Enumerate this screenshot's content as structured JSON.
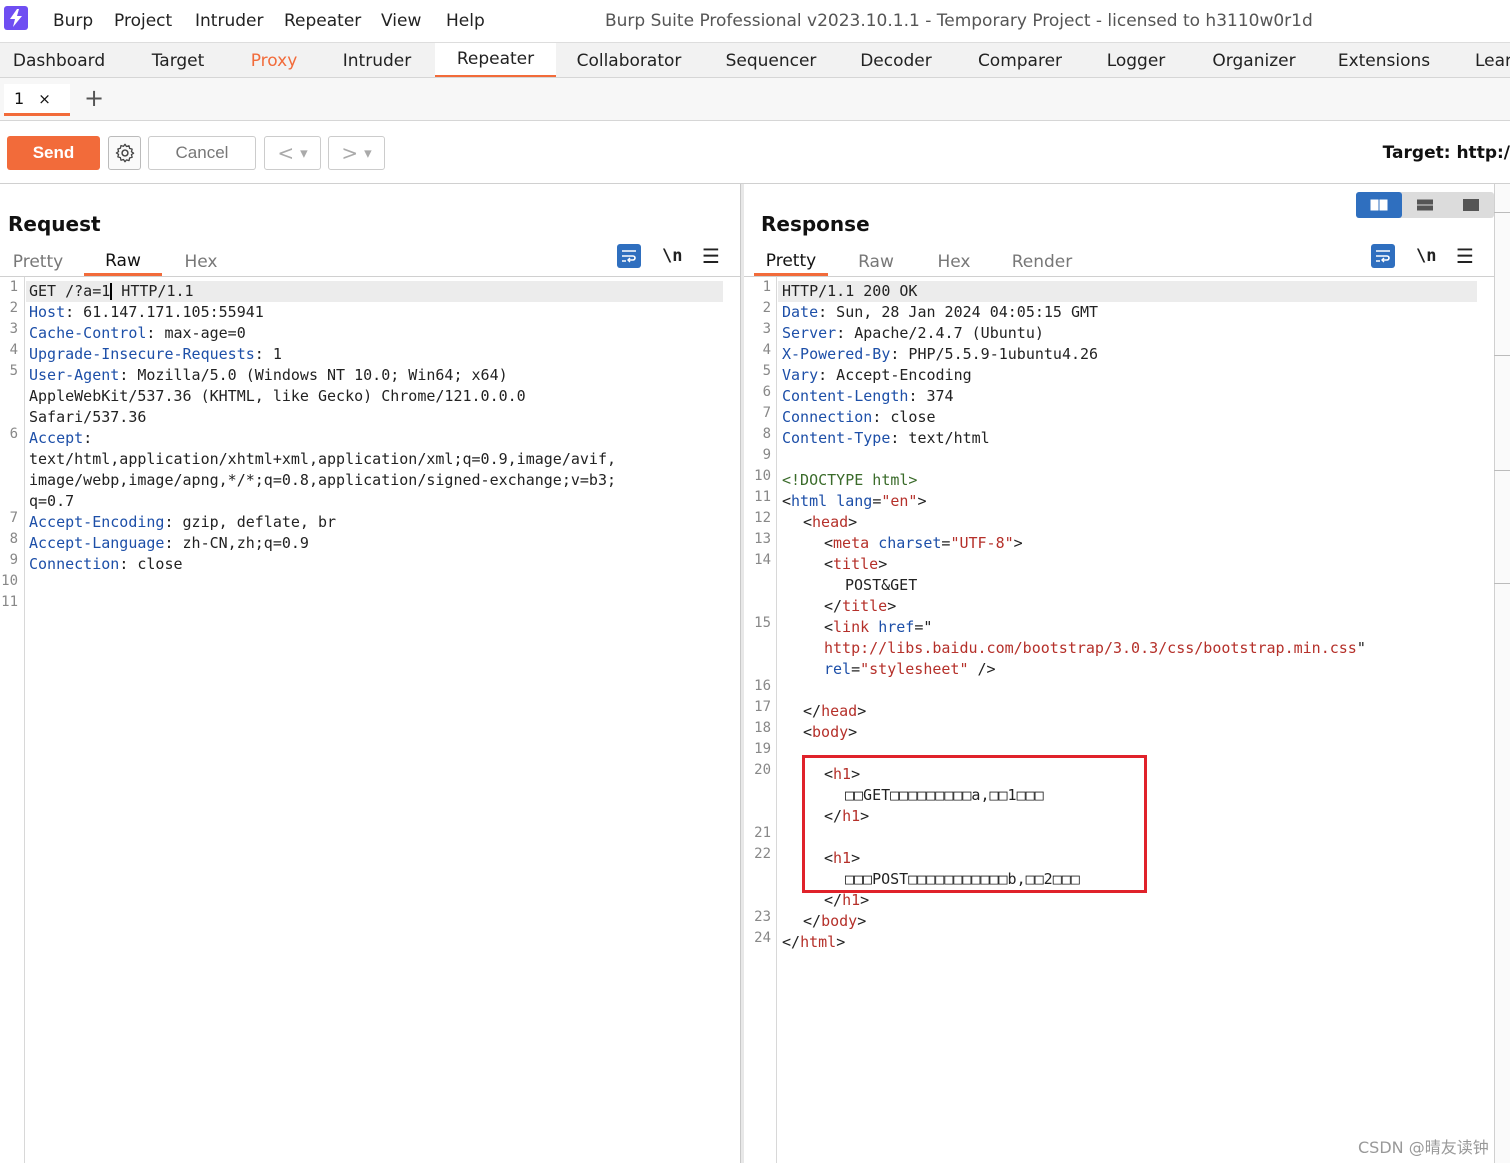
{
  "menubar": {
    "items": [
      "Burp",
      "Project",
      "Intruder",
      "Repeater",
      "View",
      "Help"
    ],
    "window_title": "Burp Suite Professional v2023.10.1.1 - Temporary Project - licensed to h3110w0r1d"
  },
  "tool_tabs": [
    "Dashboard",
    "Target",
    "Proxy",
    "Intruder",
    "Repeater",
    "Collaborator",
    "Sequencer",
    "Decoder",
    "Comparer",
    "Logger",
    "Organizer",
    "Extensions",
    "Lear"
  ],
  "sub_tab": {
    "label": "1",
    "close": "×",
    "add": "+"
  },
  "toolbar": {
    "send": "Send",
    "cancel": "Cancel",
    "back": "<",
    "forward": ">",
    "dropdown": "▾",
    "target": "Target: http:/"
  },
  "request": {
    "title": "Request",
    "tabs": [
      "Pretty",
      "Raw",
      "Hex"
    ],
    "active_tab": "Raw",
    "newline_label": "\\n",
    "line_numbers": [
      "1",
      "2",
      "3",
      "4",
      "5",
      "",
      "",
      "6",
      "",
      "",
      "",
      "7",
      "8",
      "9",
      "10",
      "11"
    ],
    "lines": {
      "l1a": "GET /?a=1",
      "l1b": " HTTP/1.1",
      "l2k": "Host",
      "l2v": ": 61.147.171.105:55941",
      "l3k": "Cache-Control",
      "l3v": ": max-age=0",
      "l4k": "Upgrade-Insecure-Requests",
      "l4v": ": 1",
      "l5k": "User-Agent",
      "l5v": ": Mozilla/5.0 (Windows NT 10.0; Win64; x64)",
      "l5b": "AppleWebKit/537.36 (KHTML, like Gecko) Chrome/121.0.0.0",
      "l5c": "Safari/537.36",
      "l6k": "Accept",
      "l6v": ":",
      "l6b": "text/html,application/xhtml+xml,application/xml;q=0.9,image/avif,",
      "l6c": "image/webp,image/apng,*/*;q=0.8,application/signed-exchange;v=b3;",
      "l6d": "q=0.7",
      "l7k": "Accept-Encoding",
      "l7v": ": gzip, deflate, br",
      "l8k": "Accept-Language",
      "l8v": ": zh-CN,zh;q=0.9",
      "l9k": "Connection",
      "l9v": ": close"
    }
  },
  "response": {
    "title": "Response",
    "tabs": [
      "Pretty",
      "Raw",
      "Hex",
      "Render"
    ],
    "active_tab": "Pretty",
    "newline_label": "\\n",
    "line_numbers": [
      "1",
      "2",
      "3",
      "4",
      "5",
      "6",
      "7",
      "8",
      "9",
      "10",
      "11",
      "12",
      "13",
      "14",
      "",
      "",
      "15",
      "",
      "",
      "16",
      "17",
      "18",
      "19",
      "20",
      "",
      "",
      "21",
      "22",
      "",
      "",
      "23",
      "24"
    ],
    "lines": {
      "r1": "HTTP/1.1 200 OK",
      "r2k": "Date",
      "r2v": ": Sun, 28 Jan 2024 04:05:15 GMT",
      "r3k": "Server",
      "r3v": ": Apache/2.4.7 (Ubuntu)",
      "r4k": "X-Powered-By",
      "r4v": ": PHP/5.5.9-1ubuntu4.26",
      "r5k": "Vary",
      "r5v": ": Accept-Encoding",
      "r6k": "Content-Length",
      "r6v": ": 374",
      "r7k": "Connection",
      "r7v": ": close",
      "r8k": "Content-Type",
      "r8v": ": text/html",
      "r10": "<!DOCTYPE html>",
      "r11a": "html",
      "r11at": "lang",
      "r11av": "\"en\"",
      "r12": "head",
      "r13a": "meta",
      "r13at": "charset",
      "r13av": "\"UTF-8\"",
      "r14": "title",
      "r14b": "POST&GET",
      "r14c": "title",
      "r15a": "link",
      "r15at": "href",
      "r15url": "http://libs.baidu.com/bootstrap/3.0.3/css/bootstrap.min.css",
      "r15rel": "rel",
      "r15relv": "\"stylesheet\"",
      "r17": "head",
      "r18": "body",
      "r20": "h1",
      "r20b": "□□GET□□□□□□□□□a,□□1□□□",
      "r20c": "h1",
      "r22": "h1",
      "r22b": "□□□POST□□□□□□□□□□□b,□□2□□□",
      "r22c": "h1",
      "r23": "body",
      "r24": "html"
    }
  },
  "watermark": "CSDN @晴友读钟",
  "colors": {
    "accent": "#f26b3a",
    "blue": "#2f6fbf",
    "highlight": "#e0222a"
  }
}
